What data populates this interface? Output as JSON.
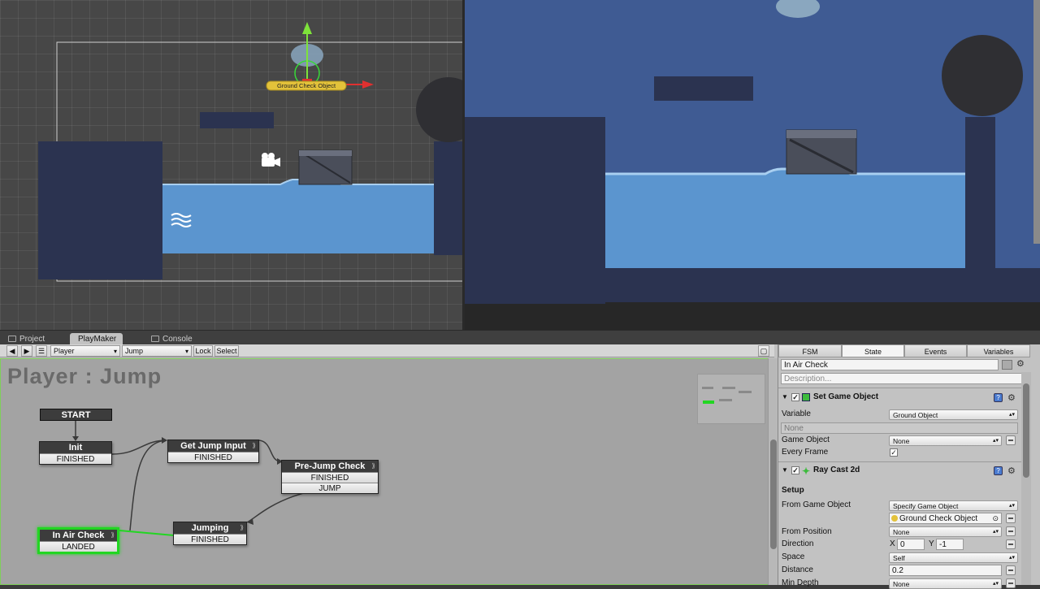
{
  "scene": {
    "gizmo_label": "Ground Check Object"
  },
  "tabs": {
    "project": "Project",
    "playmaker": "PlayMaker",
    "console": "Console"
  },
  "toolbar": {
    "fsm_owner": "Player",
    "fsm_name": "Jump",
    "lock": "Lock",
    "select": "Select"
  },
  "graph": {
    "title": "Player : Jump",
    "start_label": "START",
    "states": [
      {
        "name": "Init",
        "events": [
          "FINISHED"
        ]
      },
      {
        "name": "Get Jump Input",
        "events": [
          "FINISHED"
        ]
      },
      {
        "name": "Pre-Jump Check",
        "events": [
          "FINISHED",
          "JUMP"
        ]
      },
      {
        "name": "In Air Check",
        "events": [
          "LANDED"
        ]
      },
      {
        "name": "Jumping",
        "events": [
          "FINISHED"
        ]
      }
    ]
  },
  "inspector": {
    "tabs": [
      "FSM",
      "State",
      "Events",
      "Variables"
    ],
    "active_tab": "State",
    "state_name": "In Air Check",
    "description_placeholder": "Description...",
    "actions": [
      {
        "title": "Set Game Object",
        "fields": [
          {
            "label": "Variable",
            "value": "Ground Object"
          },
          {
            "label": "",
            "value": "None"
          },
          {
            "label": "Game Object",
            "value": "None"
          },
          {
            "label": "Every Frame",
            "value": "checked"
          }
        ]
      },
      {
        "title": "Ray Cast 2d",
        "section": "Setup",
        "fields": [
          {
            "label": "From Game Object",
            "value": "Specify Game Object"
          },
          {
            "label": "",
            "value": "Ground Check Object"
          },
          {
            "label": "From Position",
            "value": "None"
          },
          {
            "label": "Direction",
            "x_label": "X",
            "x": "0",
            "y_label": "Y",
            "y": "-1"
          },
          {
            "label": "Space",
            "value": "Self"
          },
          {
            "label": "Distance",
            "value": "0.2"
          },
          {
            "label": "Min Depth",
            "value": "None"
          }
        ]
      }
    ]
  },
  "colors": {
    "water": "#5b95cf",
    "game_bg": "#3f5b93",
    "selected_state": "#22d622"
  }
}
